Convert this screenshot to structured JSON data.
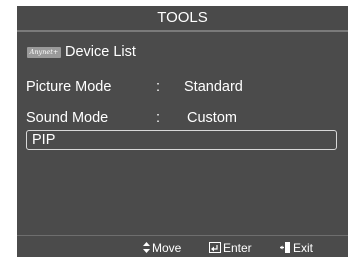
{
  "window": {
    "title": "TOOLS"
  },
  "menu": {
    "device_list": {
      "logo_text": "Anynet+",
      "label": "Device List"
    },
    "picture_mode": {
      "label": "Picture Mode",
      "separator": ":",
      "value": "Standard"
    },
    "sound_mode": {
      "label": "Sound Mode",
      "separator": ":",
      "value": "Custom"
    },
    "pip": {
      "label": "PIP",
      "selected": true
    }
  },
  "footer": {
    "move": {
      "icon": "up-down-arrows-icon",
      "label": "Move"
    },
    "enter": {
      "icon": "enter-icon",
      "label": "Enter"
    },
    "exit": {
      "icon": "exit-icon",
      "label": "Exit"
    }
  },
  "colors": {
    "panel_background": "#4b4b4b",
    "text": "#ffffff",
    "selection_border": "#d8d8d8",
    "divider": "#7a7a7a"
  }
}
